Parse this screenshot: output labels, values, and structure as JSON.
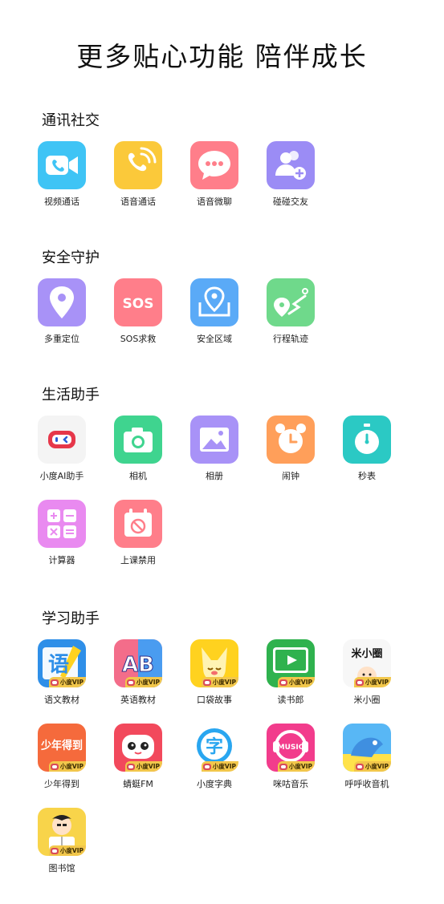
{
  "page": {
    "title": "更多贴心功能 陪伴成长"
  },
  "sections": [
    {
      "title": "通讯社交",
      "apps": [
        {
          "label": "视频通话",
          "icon": "video-call-icon",
          "color": "#3fc4f5"
        },
        {
          "label": "语音通话",
          "icon": "voice-call-icon",
          "color": "#fbc93a"
        },
        {
          "label": "语音微聊",
          "icon": "chat-bubble-icon",
          "color": "#ff7e8a"
        },
        {
          "label": "碰碰交友",
          "icon": "add-friend-icon",
          "color": "#9b8cf5"
        }
      ]
    },
    {
      "title": "安全守护",
      "apps": [
        {
          "label": "多重定位",
          "icon": "location-pin-icon",
          "color": "#a892f7"
        },
        {
          "label": "SOS求救",
          "icon": "sos-icon",
          "color": "#ff7e8a",
          "icon_text": "SOS"
        },
        {
          "label": "安全区域",
          "icon": "safe-zone-icon",
          "color": "#5aaaf7"
        },
        {
          "label": "行程轨迹",
          "icon": "route-icon",
          "color": "#6fd98b"
        }
      ]
    },
    {
      "title": "生活助手",
      "apps": [
        {
          "label": "小度AI助手",
          "icon": "xiaodu-ai-icon",
          "color": "#f4f4f4"
        },
        {
          "label": "相机",
          "icon": "camera-icon",
          "color": "#3fd48f"
        },
        {
          "label": "相册",
          "icon": "photo-album-icon",
          "color": "#a892f7"
        },
        {
          "label": "闹钟",
          "icon": "alarm-clock-icon",
          "color": "#ff9f5a"
        },
        {
          "label": "秒表",
          "icon": "stopwatch-icon",
          "color": "#2bc9c4"
        },
        {
          "label": "计算器",
          "icon": "calculator-icon",
          "color": "#e98af0"
        },
        {
          "label": "上课禁用",
          "icon": "class-disable-icon",
          "color": "#ff7e8a"
        }
      ]
    },
    {
      "title": "学习助手",
      "vip_badge": "小度VIP",
      "apps": [
        {
          "label": "语文教材",
          "icon": "chinese-textbook-icon",
          "color": "#2f8fe8",
          "icon_text": "语",
          "vip": true
        },
        {
          "label": "英语教材",
          "icon": "english-textbook-icon",
          "color": "#7b5df2",
          "icon_text": "AB",
          "vip": true
        },
        {
          "label": "口袋故事",
          "icon": "pocket-story-icon",
          "color": "#ffd21f",
          "vip": true
        },
        {
          "label": "读书郎",
          "icon": "reading-boy-icon",
          "color": "#2fb24e",
          "vip": true
        },
        {
          "label": "米小圈",
          "icon": "mi-xiaoquan-icon",
          "color": "#f7f7f7",
          "icon_text": "米小圈",
          "vip": true
        },
        {
          "label": "少年得到",
          "icon": "shaonian-dedao-icon",
          "color": "#f56a3c",
          "icon_text": "少年得到",
          "vip": true
        },
        {
          "label": "蜻蜓FM",
          "icon": "dragonfly-fm-icon",
          "color": "#f2495c",
          "vip": true
        },
        {
          "label": "小度字典",
          "icon": "dictionary-icon",
          "color": "#29a6f0",
          "icon_text": "字",
          "vip": true
        },
        {
          "label": "咪咕音乐",
          "icon": "migu-music-icon",
          "color": "#f23c8c",
          "icon_text": "MUSIC",
          "vip": true
        },
        {
          "label": "呼呼收音机",
          "icon": "huhu-radio-icon",
          "color": "#58b7f5",
          "vip": true
        },
        {
          "label": "图书馆",
          "icon": "library-icon",
          "color": "#f8d44a",
          "vip": true
        }
      ]
    }
  ]
}
